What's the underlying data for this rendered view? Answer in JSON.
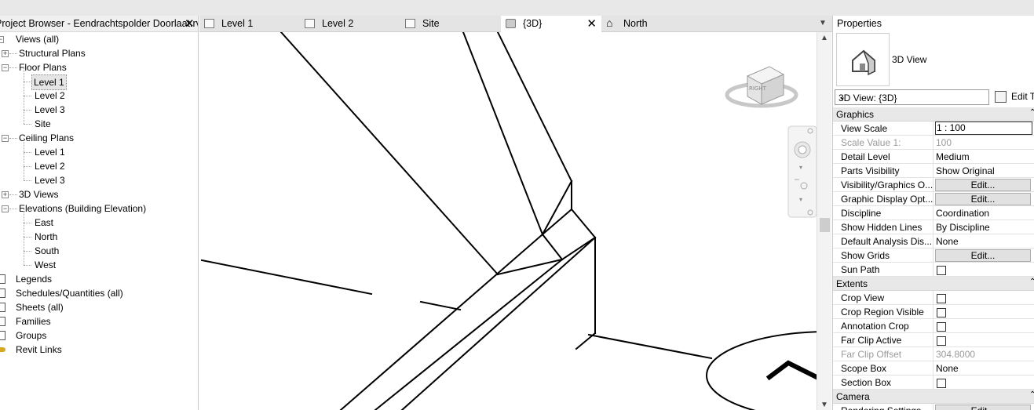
{
  "browser": {
    "title": "Project Browser - Eendrachtspolder Doorlaat.rvt",
    "tree": [
      {
        "label": "Views (all)",
        "level": 0,
        "expander": "minus",
        "icon": "views-icon"
      },
      {
        "label": "Structural Plans",
        "level": 1,
        "expander": "plus"
      },
      {
        "label": "Floor Plans",
        "level": 1,
        "expander": "minus"
      },
      {
        "label": "Level 1",
        "level": 2,
        "selected": true
      },
      {
        "label": "Level 2",
        "level": 2
      },
      {
        "label": "Level 3",
        "level": 2
      },
      {
        "label": "Site",
        "level": 2
      },
      {
        "label": "Ceiling Plans",
        "level": 1,
        "expander": "minus"
      },
      {
        "label": "Level 1",
        "level": 2
      },
      {
        "label": "Level 2",
        "level": 2
      },
      {
        "label": "Level 3",
        "level": 2
      },
      {
        "label": "3D Views",
        "level": 1,
        "expander": "plus"
      },
      {
        "label": "Elevations (Building Elevation)",
        "level": 1,
        "expander": "minus"
      },
      {
        "label": "East",
        "level": 2
      },
      {
        "label": "North",
        "level": 2
      },
      {
        "label": "South",
        "level": 2
      },
      {
        "label": "West",
        "level": 2
      },
      {
        "label": "Legends",
        "level": 0,
        "icon": "legends-icon"
      },
      {
        "label": "Schedules/Quantities (all)",
        "level": 0,
        "icon": "schedules-icon"
      },
      {
        "label": "Sheets (all)",
        "level": 0,
        "icon": "sheets-icon"
      },
      {
        "label": "Families",
        "level": 0,
        "icon": "families-icon"
      },
      {
        "label": "Groups",
        "level": 0,
        "icon": "groups-icon"
      },
      {
        "label": "Revit Links",
        "level": 0,
        "icon": "revit-links-icon"
      }
    ]
  },
  "tabs": [
    {
      "label": "Level 1",
      "icon": "floor-plan-icon"
    },
    {
      "label": "Level 2",
      "icon": "floor-plan-icon"
    },
    {
      "label": "Site",
      "icon": "floor-plan-icon"
    },
    {
      "label": "{3D}",
      "icon": "3d-view-icon",
      "active": true
    },
    {
      "label": "North",
      "icon": "elevation-icon"
    }
  ],
  "viewcube": {
    "face_label": "RIGHT"
  },
  "properties": {
    "title": "Properties",
    "type_name": "3D View",
    "instance_selector": "3D View: {3D}",
    "edit_type_label": "Edit Type",
    "groups": [
      {
        "name": "Graphics",
        "rows": [
          {
            "name": "View Scale",
            "value": "1 : 100",
            "kind": "boxed"
          },
          {
            "name": "Scale Value    1:",
            "value": "100",
            "kind": "text",
            "disabled": true
          },
          {
            "name": "Detail Level",
            "value": "Medium",
            "kind": "text"
          },
          {
            "name": "Parts Visibility",
            "value": "Show Original",
            "kind": "text"
          },
          {
            "name": "Visibility/Graphics O...",
            "value": "Edit...",
            "kind": "button"
          },
          {
            "name": "Graphic Display Opt...",
            "value": "Edit...",
            "kind": "button"
          },
          {
            "name": "Discipline",
            "value": "Coordination",
            "kind": "text"
          },
          {
            "name": "Show Hidden Lines",
            "value": "By Discipline",
            "kind": "text"
          },
          {
            "name": "Default Analysis Dis...",
            "value": "None",
            "kind": "text"
          },
          {
            "name": "Show Grids",
            "value": "Edit...",
            "kind": "button"
          },
          {
            "name": "Sun Path",
            "value": "",
            "kind": "checkbox"
          }
        ]
      },
      {
        "name": "Extents",
        "rows": [
          {
            "name": "Crop View",
            "value": "",
            "kind": "checkbox"
          },
          {
            "name": "Crop Region Visible",
            "value": "",
            "kind": "checkbox"
          },
          {
            "name": "Annotation Crop",
            "value": "",
            "kind": "checkbox"
          },
          {
            "name": "Far Clip Active",
            "value": "",
            "kind": "checkbox"
          },
          {
            "name": "Far Clip Offset",
            "value": "304.8000",
            "kind": "text",
            "disabled": true
          },
          {
            "name": "Scope Box",
            "value": "None",
            "kind": "text"
          },
          {
            "name": "Section Box",
            "value": "",
            "kind": "checkbox"
          }
        ]
      },
      {
        "name": "Camera",
        "rows": [
          {
            "name": "Rendering Settings",
            "value": "Edit...",
            "kind": "button"
          }
        ]
      }
    ]
  }
}
